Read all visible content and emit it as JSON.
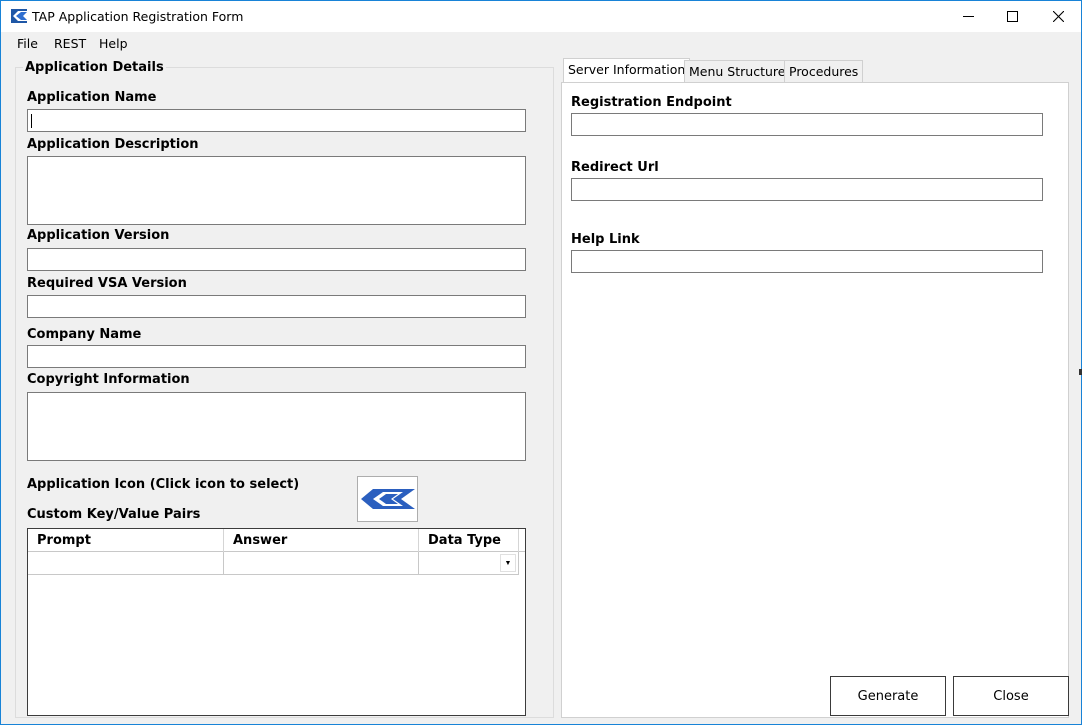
{
  "window": {
    "title": "TAP Application Registration Form",
    "icon": "tap-app-icon",
    "minimize_icon": "minimize-icon",
    "maximize_icon": "maximize-icon",
    "close_icon": "close-icon",
    "accent_color": "#1883d7",
    "logo_color": "#2b5fbf"
  },
  "menu": {
    "items": [
      {
        "label": "File"
      },
      {
        "label": "REST"
      },
      {
        "label": "Help"
      }
    ]
  },
  "details": {
    "group_title": "Application Details",
    "app_name_label": "Application Name",
    "app_name_value": "",
    "app_description_label": "Application Description",
    "app_description_value": "",
    "app_version_label": "Application Version",
    "app_version_value": "",
    "vsa_version_label": "Required VSA Version",
    "vsa_version_value": "",
    "company_label": "Company Name",
    "company_value": "",
    "copyright_label": "Copyright Information",
    "copyright_value": "",
    "icon_label": "Application Icon (Click icon to select)",
    "kv_label": "Custom Key/Value Pairs",
    "grid": {
      "columns": [
        "Prompt",
        "Answer",
        "Data Type"
      ],
      "rows": [
        {
          "prompt": "",
          "answer": "",
          "data_type": ""
        }
      ]
    }
  },
  "tabs": {
    "items": [
      {
        "label": "Server Information",
        "active": true
      },
      {
        "label": "Menu Structure",
        "active": false
      },
      {
        "label": "Procedures",
        "active": false
      }
    ]
  },
  "server": {
    "registration_label": "Registration Endpoint",
    "registration_value": "",
    "redirect_label": "Redirect Url",
    "redirect_value": "",
    "help_label": "Help Link",
    "help_value": ""
  },
  "actions": {
    "generate_label": "Generate",
    "close_label": "Close"
  }
}
